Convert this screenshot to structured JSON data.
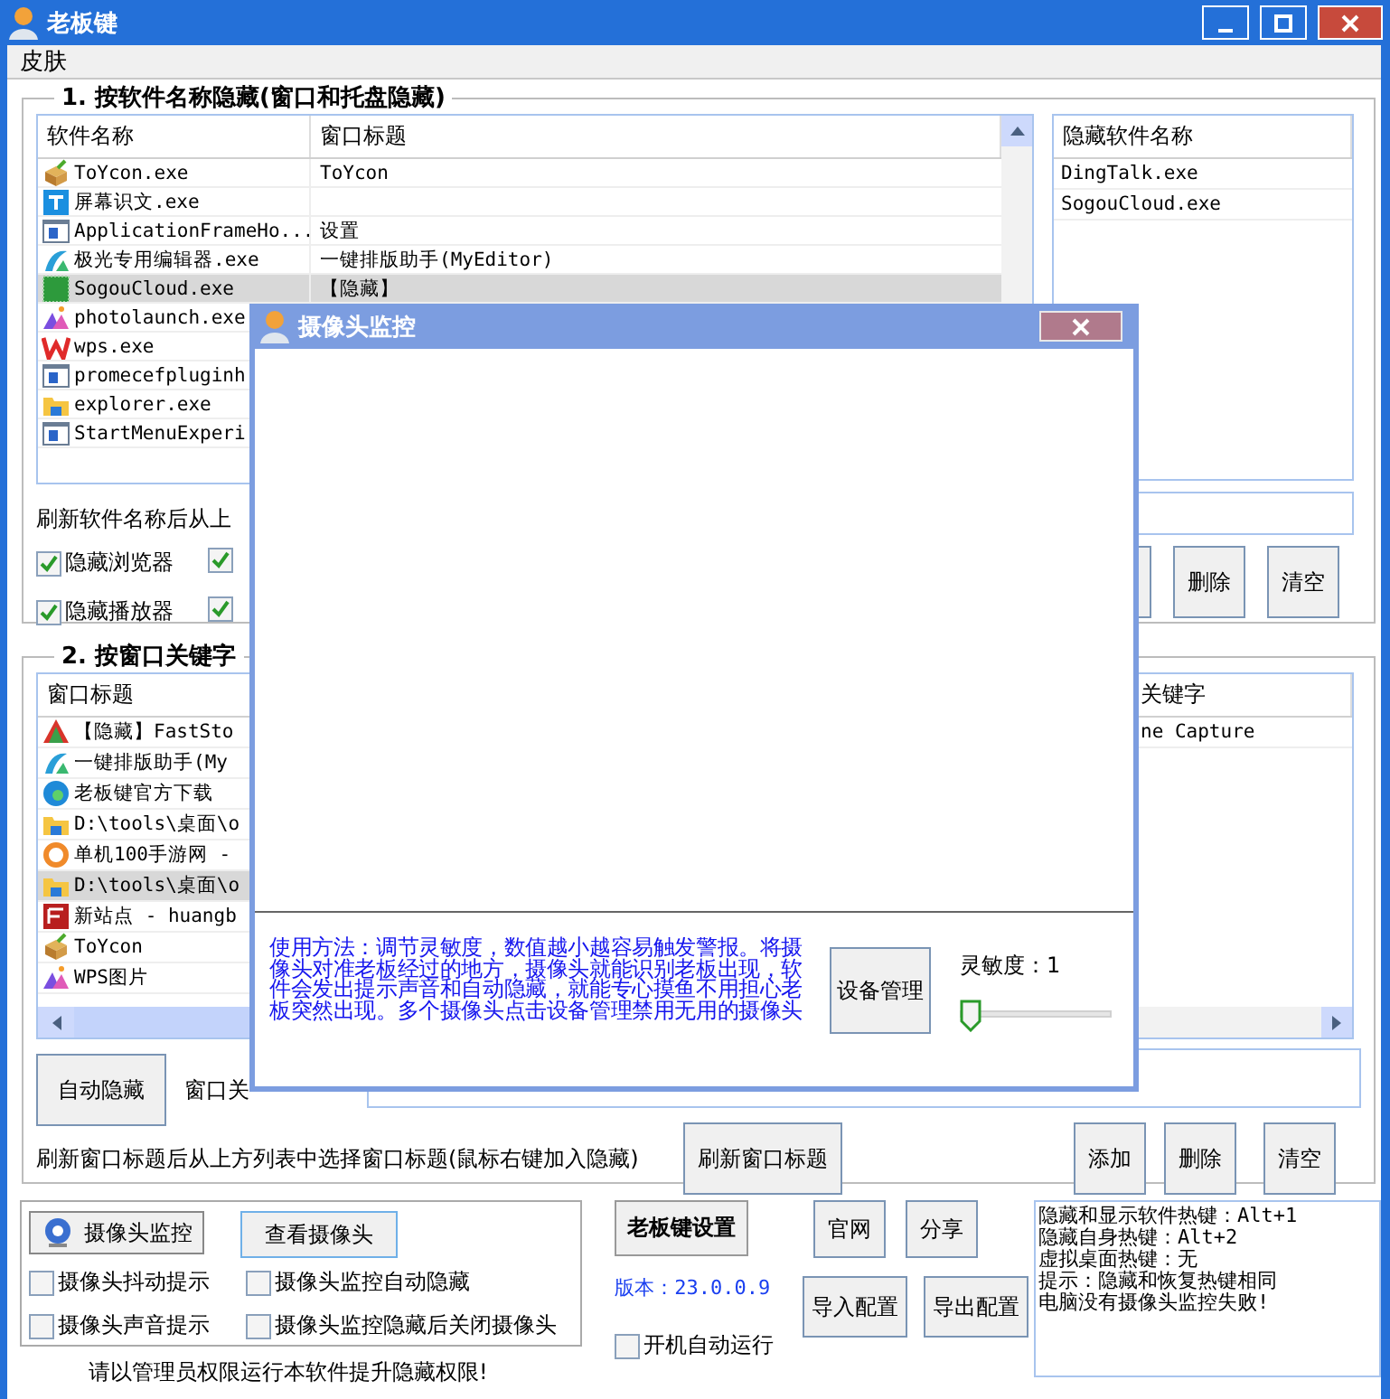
{
  "window": {
    "title": "老板键"
  },
  "menu": [
    {
      "label": "皮肤"
    }
  ],
  "software_group": {
    "title": "1. 按软件名称隐藏(窗口和托盘隐藏)",
    "table": {
      "columns": [
        "软件名称",
        "窗口标题"
      ],
      "rows": [
        {
          "name": "ToYcon.exe",
          "title": "ToYcon",
          "selected": false
        },
        {
          "name": "屏幕识文.exe",
          "selected": false
        },
        {
          "name": "ApplicationFrameHo...",
          "title": "设置",
          "selected": false
        },
        {
          "name": "极光专用编辑器.exe",
          "title": "一键排版助手(MyEditor)",
          "selected": false
        },
        {
          "name": "SogouCloud.exe",
          "title": "【隐藏】",
          "selected": true
        },
        {
          "name": "photolaunch.exe",
          "selected": false
        },
        {
          "name": "wps.exe",
          "selected": false
        },
        {
          "name": "promecefpluginh",
          "selected": false
        },
        {
          "name": "explorer.exe",
          "selected": false
        },
        {
          "name": "StartMenuExperi",
          "selected": false
        }
      ]
    },
    "hidden_list": {
      "header": "隐藏软件名称",
      "rows": [
        "DingTalk.exe",
        "SogouCloud.exe"
      ]
    },
    "hint": "刷新软件名称后从上",
    "checkboxes": [
      {
        "label": "隐藏浏览器",
        "checked": true
      },
      {
        "checked": true
      },
      {
        "label": "隐藏播放器",
        "checked": true
      },
      {
        "checked": true
      }
    ],
    "buttons": [
      "删除",
      "清空"
    ]
  },
  "keyword_group": {
    "title": "2. 按窗口关键字",
    "table": {
      "columns": [
        "窗口标题"
      ],
      "rows": [
        {
          "title": "【隐藏】FastSto",
          "selected": false
        },
        {
          "title": "一键排版助手(My",
          "selected": false
        },
        {
          "title": "老板键官方下载",
          "selected": false
        },
        {
          "title": "D:\\tools\\桌面\\o",
          "selected": false
        },
        {
          "title": "单机100手游网 -",
          "selected": false
        },
        {
          "title": "D:\\tools\\桌面\\o",
          "selected": true
        },
        {
          "title": "新站点 - huangb",
          "selected": false
        },
        {
          "title": "ToYcon",
          "selected": false
        },
        {
          "title": "WPS图片",
          "selected": false
        }
      ]
    },
    "keyword_list": {
      "header": "关键字",
      "rows": [
        "ne Capture"
      ]
    },
    "auto_hide_button": "自动隐藏",
    "keyword_label": "窗口关",
    "hint": "刷新窗口标题后从上方列表中选择窗口标题(鼠标右键加入隐藏)",
    "refresh_button": "刷新窗口标题",
    "buttons": [
      "添加",
      "删除",
      "清空"
    ]
  },
  "camera_panel": {
    "monitor_button": "摄像头监控",
    "view_button": "查看摄像头",
    "checkboxes": [
      {
        "label": "摄像头抖动提示",
        "checked": false
      },
      {
        "label": "摄像头监控自动隐藏",
        "checked": false
      },
      {
        "label": "摄像头声音提示",
        "checked": false
      },
      {
        "label": "摄像头监控隐藏后关闭摄像头",
        "checked": false
      }
    ]
  },
  "admin_notice": "请以管理员权限运行本软件提升隐藏权限!",
  "settings_button": "老板键设置",
  "version": "版本：23.0.0.9",
  "autostart": {
    "label": "开机自动运行",
    "checked": false
  },
  "config_buttons": [
    "官网",
    "分享",
    "导入配置",
    "导出配置"
  ],
  "hotkey_info": [
    "隐藏和显示软件热键：Alt+1",
    "隐藏自身热键：Alt+2",
    "虚拟桌面热键：无",
    "提示：隐藏和恢复热键相同",
    "电脑没有摄像头监控失败!"
  ],
  "camera_dialog": {
    "title": "摄像头监控",
    "usage": "使用方法：调节灵敏度，数值越小越容易触发警报。将摄像头对准老板经过的地方，摄像头就能识别老板出现，软件会发出提示声音和自动隐藏，就能专心摸鱼不用担心老板突然出现。多个摄像头点击设备管理禁用无用的摄像头",
    "device_button": "设备管理",
    "sensitivity_label": "灵敏度：1",
    "sensitivity": {
      "level": 0
    }
  }
}
